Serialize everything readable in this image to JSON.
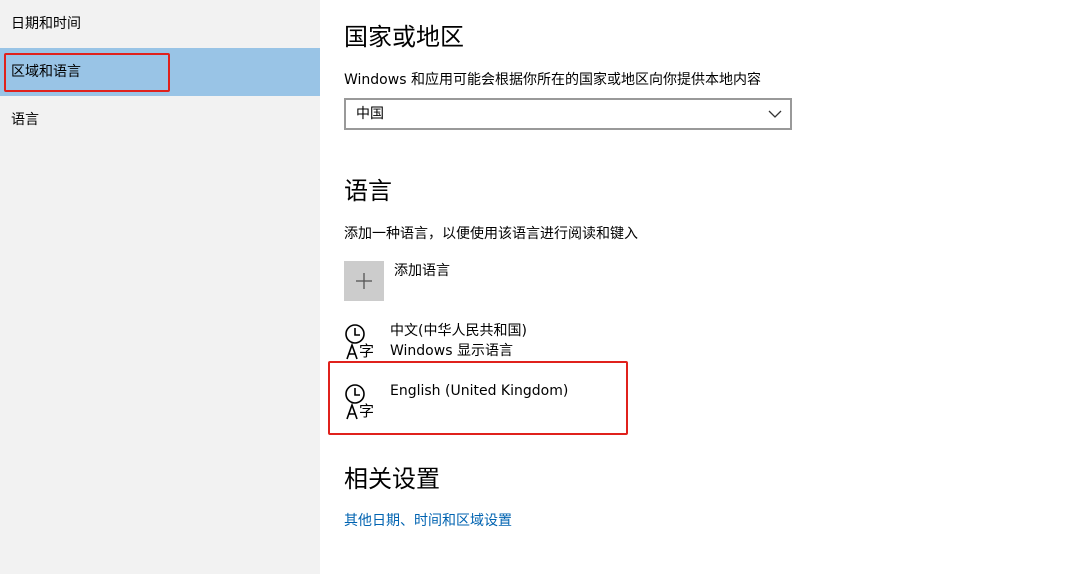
{
  "sidebar": {
    "items": [
      {
        "label": "日期和时间",
        "selected": false
      },
      {
        "label": "区域和语言",
        "selected": true
      },
      {
        "label": "语言",
        "selected": false
      }
    ]
  },
  "region": {
    "heading": "国家或地区",
    "description": "Windows 和应用可能会根据你所在的国家或地区向你提供本地内容",
    "selected_value": "中国"
  },
  "language": {
    "heading": "语言",
    "description": "添加一种语言，以便使用该语言进行阅读和键入",
    "add_label": "添加语言",
    "items": [
      {
        "name": "中文(中华人民共和国)",
        "sub": "Windows 显示语言"
      },
      {
        "name": "English (United Kingdom)",
        "sub": ""
      }
    ]
  },
  "related": {
    "heading": "相关设置",
    "link": "其他日期、时间和区域设置"
  },
  "colors": {
    "sidebar_bg": "#f2f2f2",
    "selected_bg": "#99c4e6",
    "highlight_border": "#e0211c",
    "link": "#0063b1"
  }
}
